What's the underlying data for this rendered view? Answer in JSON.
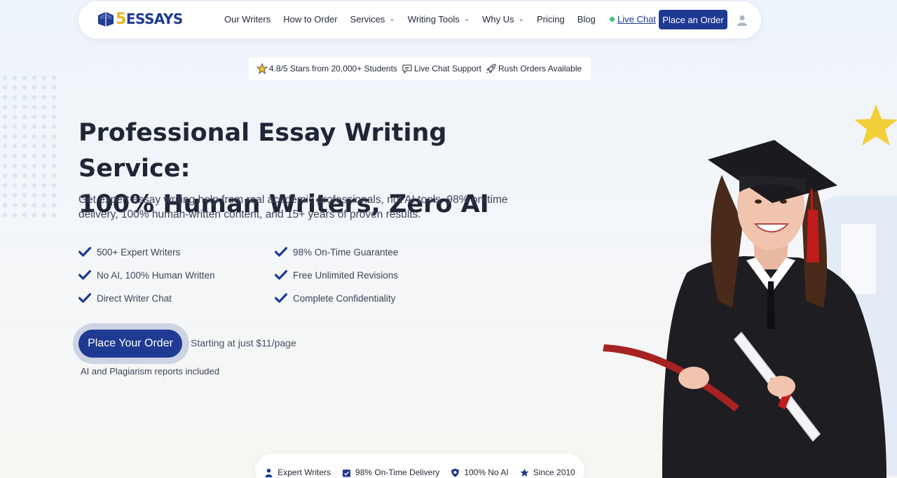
{
  "nav": {
    "logo_number": "5",
    "logo_text": "ESSAYS",
    "items": [
      {
        "label": "Our Writers",
        "dropdown": false
      },
      {
        "label": "How to Order",
        "dropdown": false
      },
      {
        "label": "Services",
        "dropdown": true
      },
      {
        "label": "Writing Tools",
        "dropdown": true
      },
      {
        "label": "Why Us",
        "dropdown": true
      },
      {
        "label": "Pricing",
        "dropdown": false
      },
      {
        "label": "Blog",
        "dropdown": false
      }
    ],
    "live_chat": "Live Chat",
    "order_button": "Place an Order",
    "user_icon": "user-icon"
  },
  "trust": {
    "rating": "4.8/5 Stars from 20,000+ Students",
    "support": "Live Chat Support",
    "rush": "Rush Orders Available"
  },
  "hero": {
    "title_line1": "Professional Essay Writing Service:",
    "title_line2": "100% Human Writers, Zero AI",
    "subtitle": "Get expert essay writing help from real academic professionals, not AI tools. 98% on-time delivery, 100% human-written content, and 15+ years of proven results.",
    "features": [
      "500+ Expert Writers",
      "98% On-Time Guarantee",
      "No AI, 100% Human Written",
      "Free Unlimited Revisions",
      "Direct Writer Chat",
      "Complete Confidentiality"
    ],
    "cta": "Place Your Order",
    "starting": "Starting at just $11/page",
    "reports": "AI and Plagiarism reports included"
  },
  "bottom_bar": [
    {
      "label": "Expert Writers",
      "icon": "writer-icon"
    },
    {
      "label": "98% On-Time Delivery",
      "icon": "calendar-check-icon"
    },
    {
      "label": "100% No AI",
      "icon": "shield-icon"
    },
    {
      "label": "Since 2010",
      "icon": "star-icon"
    }
  ],
  "colors": {
    "brand": "#1f3a93",
    "accent": "#e8b422",
    "live": "#3fc37a"
  }
}
